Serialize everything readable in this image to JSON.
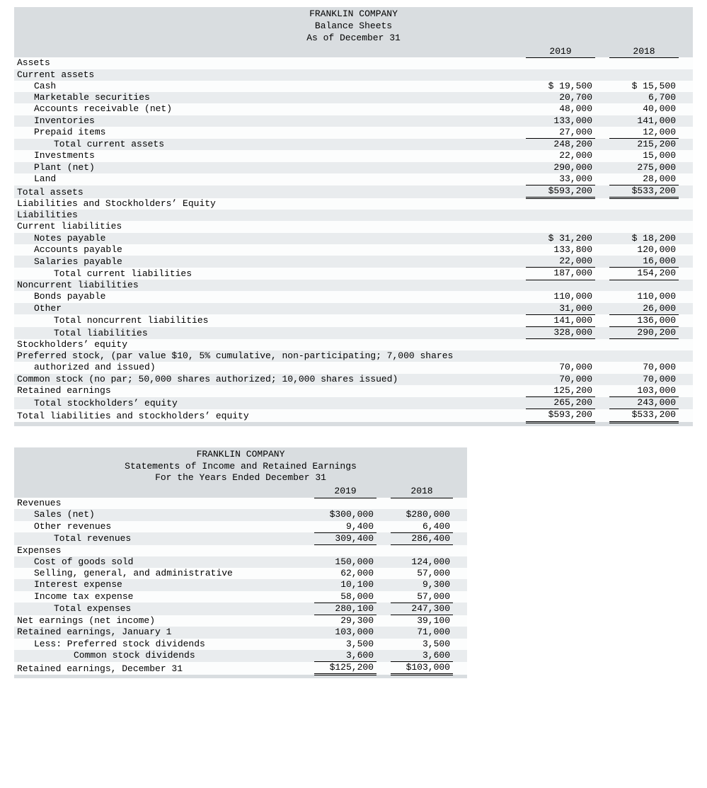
{
  "bs": {
    "company": "FRANKLIN COMPANY",
    "title": "Balance Sheets",
    "asof": "As of December 31",
    "y1": "2019",
    "y2": "2018",
    "assets_hdr": "Assets",
    "ca_hdr": "Current assets",
    "cash_l": "Cash",
    "cash_1": "$ 19,500",
    "cash_2": "$ 15,500",
    "ms_l": "Marketable securities",
    "ms_1": "20,700",
    "ms_2": "6,700",
    "ar_l": "Accounts receivable (net)",
    "ar_1": "48,000",
    "ar_2": "40,000",
    "inv_l": "Inventories",
    "inv_1": "133,000",
    "inv_2": "141,000",
    "pre_l": "Prepaid items",
    "pre_1": "27,000",
    "pre_2": "12,000",
    "tca_l": "Total current assets",
    "tca_1": "248,200",
    "tca_2": "215,200",
    "invst_l": "Investments",
    "invst_1": "22,000",
    "invst_2": "15,000",
    "plant_l": "Plant (net)",
    "plant_1": "290,000",
    "plant_2": "275,000",
    "land_l": "Land",
    "land_1": "33,000",
    "land_2": "28,000",
    "ta_l": "Total assets",
    "ta_1": "$593,200",
    "ta_2": "$533,200",
    "lse_hdr": "Liabilities and Stockholders’ Equity",
    "liab_hdr": "Liabilities",
    "cl_hdr": "Current liabilities",
    "np_l": "Notes payable",
    "np_1": "$ 31,200",
    "np_2": "$ 18,200",
    "ap_l": "Accounts payable",
    "ap_1": "133,800",
    "ap_2": "120,000",
    "sp_l": "Salaries payable",
    "sp_1": "22,000",
    "sp_2": "16,000",
    "tcl_l": "Total current liabilities",
    "tcl_1": "187,000",
    "tcl_2": "154,200",
    "ncl_hdr": "Noncurrent liabilities",
    "bp_l": "Bonds payable",
    "bp_1": "110,000",
    "bp_2": "110,000",
    "oth_l": "Other",
    "oth_1": "31,000",
    "oth_2": "26,000",
    "tncl_l": "Total noncurrent liabilities",
    "tncl_1": "141,000",
    "tncl_2": "136,000",
    "tl_l": "Total liabilities",
    "tl_1": "328,000",
    "tl_2": "290,200",
    "se_hdr": "Stockholders’ equity",
    "ps_l1": "Preferred stock, (par value $10, 5% cumulative, non-participating; 7,000 shares",
    "ps_l2": "authorized and issued)",
    "ps_1": "70,000",
    "ps_2": "70,000",
    "cs_l": "Common stock (no par; 50,000 shares authorized; 10,000 shares issued)",
    "cs_1": "70,000",
    "cs_2": "70,000",
    "re_l": "Retained earnings",
    "re_1": "125,200",
    "re_2": "103,000",
    "tse_l": "Total stockholders’ equity",
    "tse_1": "265,200",
    "tse_2": "243,000",
    "tlse_l": "Total liabilities and stockholders’ equity",
    "tlse_1": "$593,200",
    "tlse_2": "$533,200"
  },
  "is": {
    "company": "FRANKLIN COMPANY",
    "title": "Statements of Income and Retained Earnings",
    "period": "For the Years Ended December 31",
    "y1": "2019",
    "y2": "2018",
    "rev_hdr": "Revenues",
    "sales_l": "Sales (net)",
    "sales_1": "$300,000",
    "sales_2": "$280,000",
    "orev_l": "Other revenues",
    "orev_1": "9,400",
    "orev_2": "6,400",
    "trev_l": "Total revenues",
    "trev_1": "309,400",
    "trev_2": "286,400",
    "exp_hdr": "Expenses",
    "cogs_l": "Cost of goods sold",
    "cogs_1": "150,000",
    "cogs_2": "124,000",
    "sga_l": "Selling, general, and administrative",
    "sga_1": "62,000",
    "sga_2": "57,000",
    "int_l": "Interest expense",
    "int_1": "10,100",
    "int_2": "9,300",
    "tax_l": "Income tax expense",
    "tax_1": "58,000",
    "tax_2": "57,000",
    "texp_l": "Total expenses",
    "texp_1": "280,100",
    "texp_2": "247,300",
    "ne_l": "Net earnings (net income)",
    "ne_1": "29,300",
    "ne_2": "39,100",
    "rej1_l": "Retained earnings, January 1",
    "rej1_1": "103,000",
    "rej1_2": "71,000",
    "psd_l": "Less: Preferred stock dividends",
    "psd_1": "3,500",
    "psd_2": "3,500",
    "csd_l": "Common stock dividends",
    "csd_1": "3,600",
    "csd_2": "3,600",
    "red_l": "Retained earnings, December 31",
    "red_1": "$125,200",
    "red_2": "$103,000"
  }
}
